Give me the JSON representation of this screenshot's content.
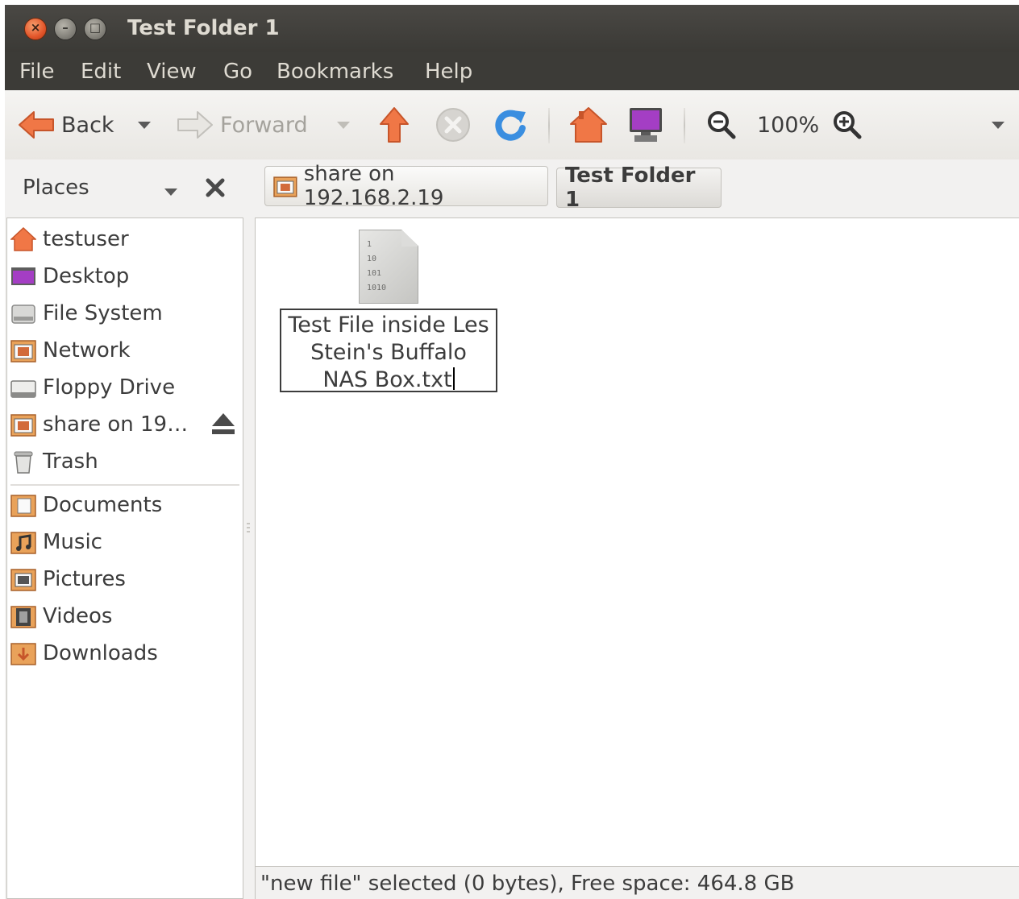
{
  "window": {
    "title": "Test Folder 1",
    "controls": {
      "close": "×",
      "minimize": "–",
      "maximize": "□"
    }
  },
  "menu": [
    "File",
    "Edit",
    "View",
    "Go",
    "Bookmarks",
    "Help"
  ],
  "toolbar": {
    "back_label": "Back",
    "forward_label": "Forward",
    "zoom_level": "100%",
    "icons": [
      "back-arrow-icon",
      "forward-arrow-icon",
      "up-arrow-icon",
      "stop-icon",
      "reload-icon",
      "home-icon",
      "computer-icon",
      "zoom-out-icon",
      "zoom-in-icon"
    ]
  },
  "location": {
    "places_label": "Places",
    "breadcrumbs": [
      "share on 192.168.2.19",
      "Test Folder 1"
    ]
  },
  "sidebar": {
    "devices": [
      {
        "label": "testuser",
        "icon": "home-folder-icon"
      },
      {
        "label": "Desktop",
        "icon": "desktop-icon"
      },
      {
        "label": "File System",
        "icon": "hard-drive-icon"
      },
      {
        "label": "Network",
        "icon": "network-folder-icon"
      },
      {
        "label": "Floppy Drive",
        "icon": "floppy-drive-icon"
      },
      {
        "label": "share on 19…",
        "icon": "network-share-icon"
      },
      {
        "label": "Trash",
        "icon": "trash-icon"
      }
    ],
    "bookmarks": [
      {
        "label": "Documents",
        "icon": "documents-folder-icon"
      },
      {
        "label": "Music",
        "icon": "music-folder-icon"
      },
      {
        "label": "Pictures",
        "icon": "pictures-folder-icon"
      },
      {
        "label": "Videos",
        "icon": "videos-folder-icon"
      },
      {
        "label": "Downloads",
        "icon": "downloads-folder-icon"
      }
    ]
  },
  "content": {
    "file_name": "Test File inside Les Stein's Buffalo NAS Box.txt",
    "file_icon_text": "1\n10\n101\n1010"
  },
  "status": "\"new file\" selected (0 bytes), Free space: 464.8 GB",
  "colors": {
    "titlebar": "#3c3b37",
    "accent_orange": "#f07746",
    "close_button": "#e2552a"
  }
}
